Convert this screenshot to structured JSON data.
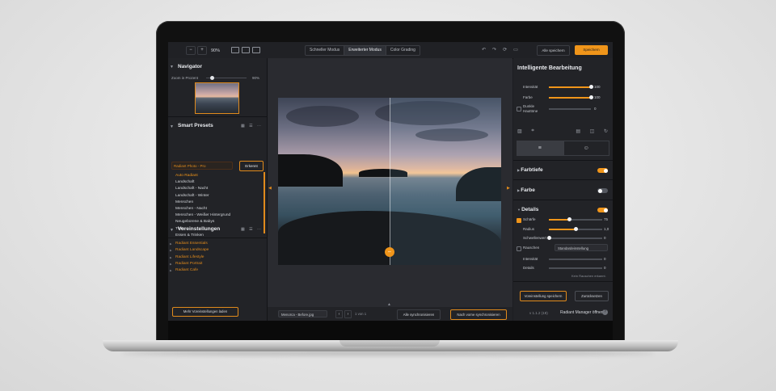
{
  "toolbar": {
    "zoom_minus": "−",
    "zoom_plus": "+",
    "zoom_value": "90%",
    "modes": [
      "Schneller Modus",
      "Erweiterter Modus",
      "Color Grading"
    ],
    "active_mode": "Erweiterter Modus",
    "undo_icons": [
      "↶",
      "↷",
      "⟳",
      "▭"
    ],
    "save_all": "Alle speichern",
    "save": "Speichern"
  },
  "navigator": {
    "title": "Navigator",
    "zoom_label": "Zoom in Prozent",
    "zoom_pct": "90%",
    "zoom_level": 0.12
  },
  "smart_presets": {
    "title": "Smart Presets",
    "selected": "Radiant Photo - Pro",
    "button": "Erkennt",
    "items": [
      "Auto Radiant",
      "Landschaft",
      "Landschaft - Nacht",
      "Landschaft - Winter",
      "Menschen",
      "Menschen - Nacht",
      "Menschen - Weißer Hintergrund",
      "Neugeborene & Babys",
      "Tiere",
      "Essen & Trinken"
    ]
  },
  "voreinstellungen": {
    "title": "Voreinstellungen",
    "items": [
      "Radiant Essentials",
      "Radiant Landscape",
      "Radiant Lifestyle",
      "Radiant Portrait",
      "Radiant Cafe"
    ],
    "more_button": "Mehr Voreinstellungen laden"
  },
  "canvas": {
    "filename": "Menorca - Before.jpg",
    "pages": "1 von 1",
    "sync_all": "Alle synchronisieren",
    "sync_back": "Nach vorne synchronisieren",
    "split_position": 0.5
  },
  "right_panel": {
    "title": "Intelligente Bearbeitung",
    "sliders": [
      {
        "label": "Intensität",
        "value": "100",
        "level": 1.0
      },
      {
        "label": "Farbe",
        "value": "100",
        "level": 1.0
      }
    ],
    "dark_skin_label_1": "Dunkle",
    "dark_skin_label_2": "Hauttöne",
    "dark_skin_value": "0",
    "sections": [
      {
        "title": "Farbtiefe",
        "on": true
      },
      {
        "title": "Farbe",
        "on": false
      },
      {
        "title": "Details",
        "on": true
      }
    ],
    "details": [
      {
        "label": "Schärfe",
        "value": "75",
        "level": 0.38
      },
      {
        "label": "Radius",
        "value": "1,0",
        "level": 0.5
      },
      {
        "label": "Schwellenwert",
        "value": "0",
        "level": 0.0
      }
    ],
    "noise_label": "Rauschen",
    "noise_mode": "Standardeinstellung",
    "noise_sliders": [
      {
        "label": "Intensität",
        "value": "0",
        "level": 0.45
      },
      {
        "label": "Details",
        "value": "0",
        "level": 0.45
      }
    ],
    "noise_note": "Kein Rauschen erkannt.",
    "save_preset": "Voreinstellung speichern",
    "reset": "Zurücksetzen",
    "version": "v 1.1.2 (19)",
    "manager": "Radiant Manager öffnen",
    "help": "?"
  },
  "colors": {
    "accent": "#f0951a",
    "panel": "#222327",
    "canvas": "#2a2b30"
  }
}
